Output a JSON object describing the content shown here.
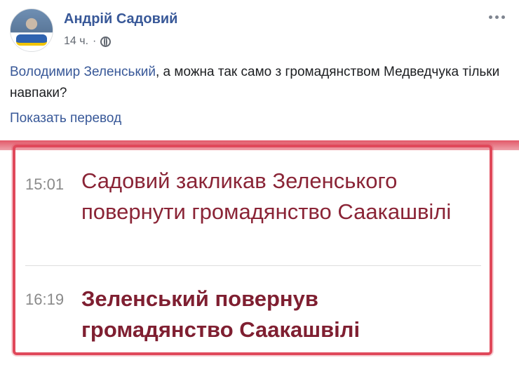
{
  "post": {
    "author": "Андрій Садовий",
    "time": "14 ч.",
    "separator": "·",
    "mention": "Володимир Зеленський",
    "text_rest": ", а можна так само з громадянством Медведчука тільки навпаки?",
    "translate_label": "Показать перевод",
    "icons": [
      "globe-icon",
      "more-icon"
    ]
  },
  "news": [
    {
      "time": "15:01",
      "title": "Садовий закликав Зеленського повернути громадянство Саакашвілі"
    },
    {
      "time": "16:19",
      "title": "Зеленський повернув громадянство Саакашвілі"
    }
  ],
  "colors": {
    "link": "#385898",
    "news_title": "#8a2436",
    "frame": "#e0485a"
  }
}
